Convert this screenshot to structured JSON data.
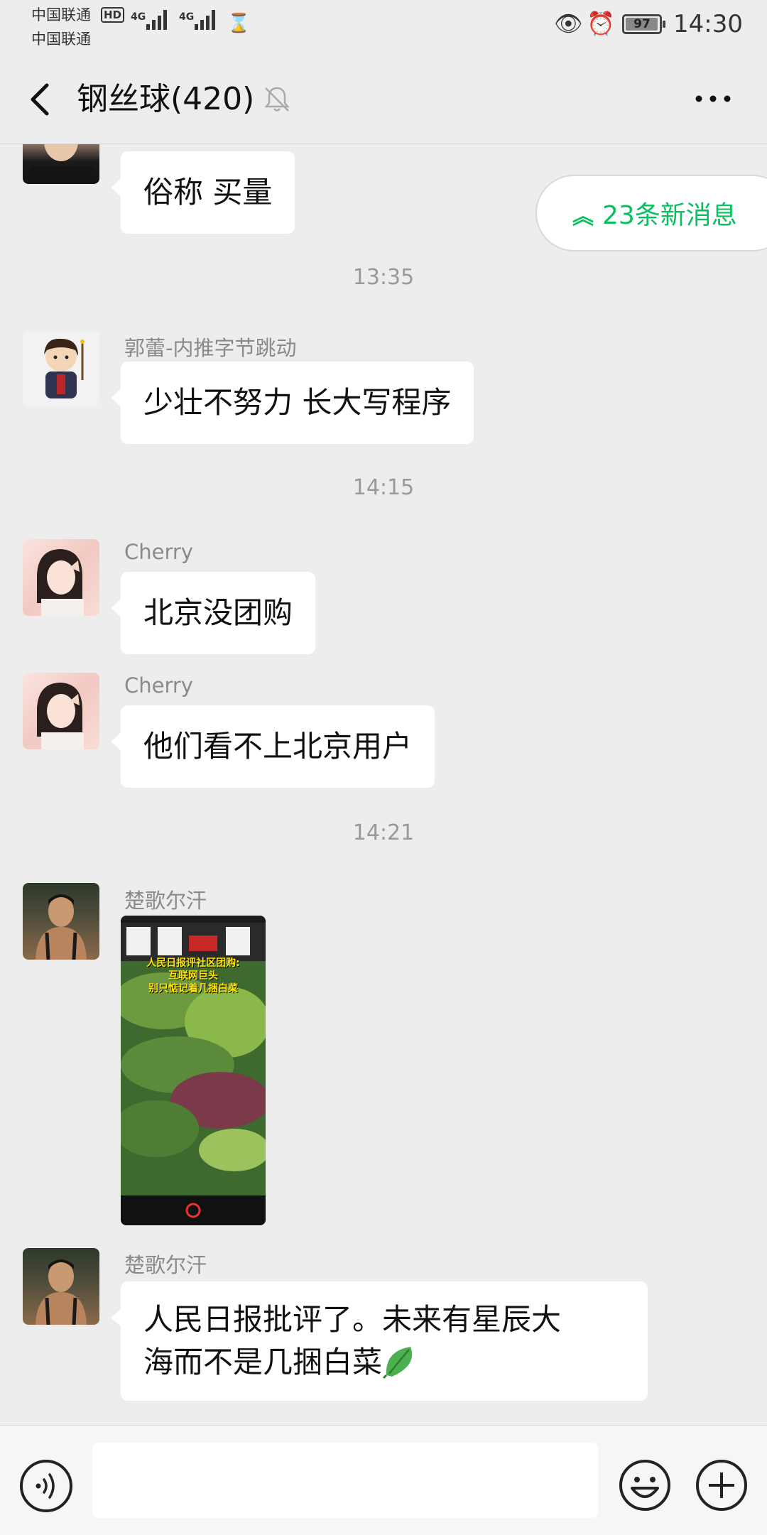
{
  "status_bar": {
    "carrier1": "中国联通",
    "carrier2": "中国联通",
    "hd_badge": "HD",
    "net1": "4G",
    "net2": "4G",
    "battery": "97",
    "battery_level": 0.97,
    "time": "14:30"
  },
  "header": {
    "title": "钢丝球(420)"
  },
  "new_messages": {
    "label": "23条新消息"
  },
  "messages": [
    {
      "type": "text",
      "sender": "",
      "text": "俗称 买量"
    },
    {
      "type": "time",
      "text": "13:35"
    },
    {
      "type": "text",
      "sender": "郭蕾-内推字节跳动",
      "text": "少壮不努力 长大写程序"
    },
    {
      "type": "time",
      "text": "14:15"
    },
    {
      "type": "text",
      "sender": "Cherry",
      "text": "北京没团购"
    },
    {
      "type": "text",
      "sender": "Cherry",
      "text": "他们看不上北京用户"
    },
    {
      "type": "time",
      "text": "14:21"
    },
    {
      "type": "image",
      "sender": "楚歌尔汗",
      "caption_line1": "人民日报评社区团购:",
      "caption_line2": "互联网巨头",
      "caption_line3": "别只惦记着几捆白菜"
    },
    {
      "type": "text",
      "sender": "楚歌尔汗",
      "text_line1": "人民日报批评了。未来有星辰大",
      "text_line2": "海而不是几捆白菜"
    }
  ],
  "icons": {
    "back": "chevron-left-icon",
    "mute": "bell-off-icon",
    "more": "more-dots-icon",
    "voice": "voice-icon",
    "emoji": "emoji-icon",
    "plus": "plus-icon"
  },
  "colors": {
    "accent": "#07c160",
    "background": "#ededed",
    "bubble": "#ffffff"
  }
}
